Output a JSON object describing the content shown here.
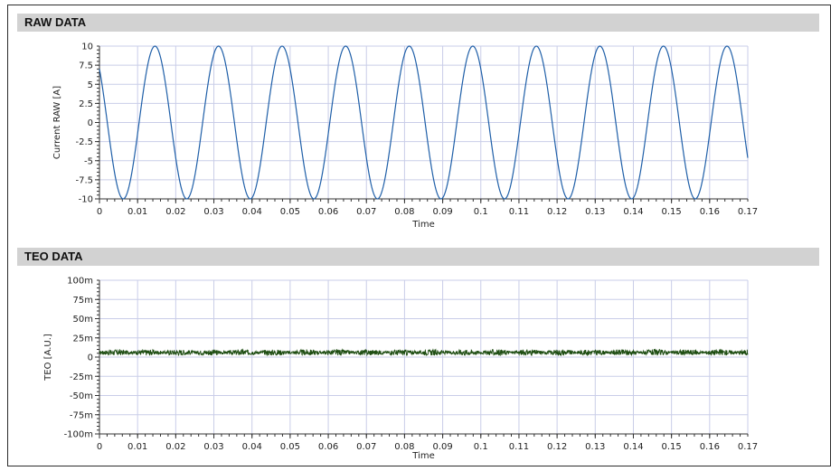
{
  "panels": {
    "raw": {
      "title": "RAW DATA"
    },
    "teo": {
      "title": "TEO DATA"
    }
  },
  "chart_data": [
    {
      "type": "line",
      "title": "RAW DATA",
      "xlabel": "Time",
      "ylabel": "Current RAW [A]",
      "xlim": [
        0,
        0.17
      ],
      "ylim": [
        -10,
        10
      ],
      "grid": true,
      "x_ticks": [
        0,
        0.01,
        0.02,
        0.03,
        0.04,
        0.05,
        0.06,
        0.07,
        0.08,
        0.09,
        0.1,
        0.11,
        0.12,
        0.13,
        0.14,
        0.15,
        0.16,
        0.17
      ],
      "x_tick_labels": [
        "0",
        "0.01",
        "0.02",
        "0.03",
        "0.04",
        "0.05",
        "0.06",
        "0.07",
        "0.08",
        "0.09",
        "0.1",
        "0.11",
        "0.12",
        "0.13",
        "0.14",
        "0.15",
        "0.16",
        "0.17"
      ],
      "y_ticks": [
        10,
        7.5,
        5,
        2.5,
        0,
        -2.5,
        -5,
        -7.5,
        -10
      ],
      "y_tick_labels": [
        "10",
        "7.5",
        "5",
        "2.5",
        "0",
        "-2.5",
        "-5",
        "-7.5",
        "-10"
      ],
      "series": [
        {
          "color": "#1f5fa8",
          "signal": {
            "kind": "sine",
            "amplitude": 10,
            "frequency_hz": 60,
            "value_at_t0": 7
          }
        }
      ]
    },
    {
      "type": "line",
      "title": "TEO DATA",
      "xlabel": "Time",
      "ylabel": "TEO [A.U.]",
      "xlim": [
        0,
        0.17
      ],
      "ylim": [
        -0.1,
        0.1
      ],
      "grid": true,
      "x_ticks": [
        0,
        0.01,
        0.02,
        0.03,
        0.04,
        0.05,
        0.06,
        0.07,
        0.08,
        0.09,
        0.1,
        0.11,
        0.12,
        0.13,
        0.14,
        0.15,
        0.16,
        0.17
      ],
      "x_tick_labels": [
        "0",
        "0.01",
        "0.02",
        "0.03",
        "0.04",
        "0.05",
        "0.06",
        "0.07",
        "0.08",
        "0.09",
        "0.1",
        "0.11",
        "0.12",
        "0.13",
        "0.14",
        "0.15",
        "0.16",
        "0.17"
      ],
      "y_ticks": [
        0.1,
        0.075,
        0.05,
        0.025,
        0,
        -0.025,
        -0.05,
        -0.075,
        -0.1
      ],
      "y_tick_labels": [
        "100m",
        "75m",
        "50m",
        "25m",
        "0",
        "-25m",
        "-50m",
        "-75m",
        "-100m"
      ],
      "series": [
        {
          "color": "#1e4d12",
          "signal": {
            "kind": "noisy-band",
            "center": 0.006,
            "noise_amplitude": 0.004,
            "burst_period_s": 0.00833
          }
        }
      ]
    }
  ]
}
